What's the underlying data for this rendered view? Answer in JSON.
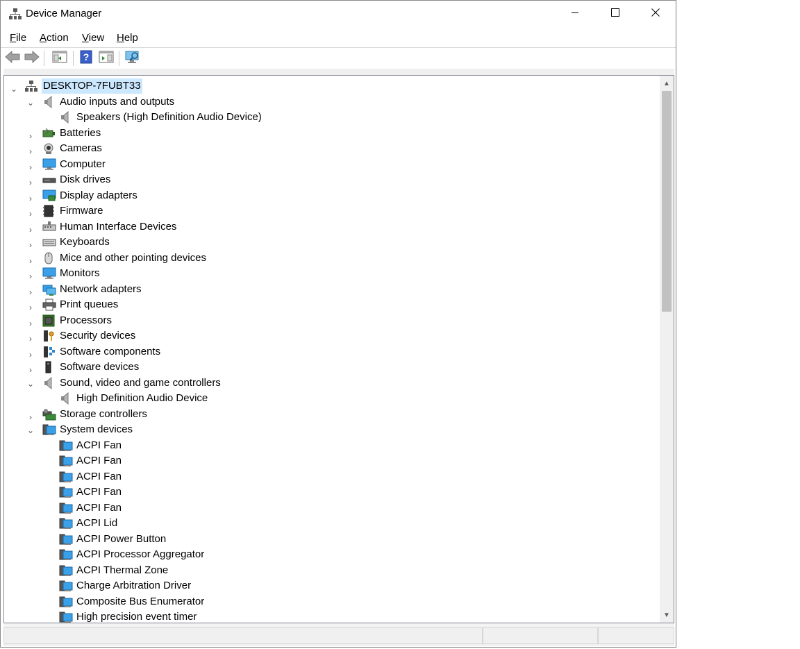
{
  "window": {
    "title": "Device Manager"
  },
  "title_buttons": {
    "minimize": "minimize-icon",
    "maximize": "maximize-icon",
    "close": "close-icon"
  },
  "menu": [
    {
      "label_first": "F",
      "label_rest": "ile"
    },
    {
      "label_first": "A",
      "label_rest": "ction"
    },
    {
      "label_first": "V",
      "label_rest": "iew"
    },
    {
      "label_first": "H",
      "label_rest": "elp"
    }
  ],
  "toolbar": [
    "back-icon",
    "forward-icon",
    "show-hide-console-tree-icon",
    "help-icon",
    "properties-icon",
    "scan-hardware-icon"
  ],
  "tree": {
    "root": "DESKTOP-7FUBT33",
    "rows": [
      {
        "label": "Audio inputs and outputs",
        "level": 1,
        "expanded": true,
        "icon": "speaker-icon"
      },
      {
        "label": "Speakers (High Definition Audio Device)",
        "level": 2,
        "icon": "speaker-icon"
      },
      {
        "label": "Batteries",
        "level": 1,
        "expanded": false,
        "icon": "battery-icon"
      },
      {
        "label": "Cameras",
        "level": 1,
        "expanded": false,
        "icon": "camera-icon"
      },
      {
        "label": "Computer",
        "level": 1,
        "expanded": false,
        "icon": "computer-icon"
      },
      {
        "label": "Disk drives",
        "level": 1,
        "expanded": false,
        "icon": "disk-drive-icon"
      },
      {
        "label": "Display adapters",
        "level": 1,
        "expanded": false,
        "icon": "display-adapter-icon"
      },
      {
        "label": "Firmware",
        "level": 1,
        "expanded": false,
        "icon": "firmware-icon"
      },
      {
        "label": "Human Interface Devices",
        "level": 1,
        "expanded": false,
        "icon": "hid-icon"
      },
      {
        "label": "Keyboards",
        "level": 1,
        "expanded": false,
        "icon": "keyboard-icon"
      },
      {
        "label": "Mice and other pointing devices",
        "level": 1,
        "expanded": false,
        "icon": "mouse-icon"
      },
      {
        "label": "Monitors",
        "level": 1,
        "expanded": false,
        "icon": "monitor-icon"
      },
      {
        "label": "Network adapters",
        "level": 1,
        "expanded": false,
        "icon": "network-adapter-icon"
      },
      {
        "label": "Print queues",
        "level": 1,
        "expanded": false,
        "icon": "printer-icon"
      },
      {
        "label": "Processors",
        "level": 1,
        "expanded": false,
        "icon": "processor-icon"
      },
      {
        "label": "Security devices",
        "level": 1,
        "expanded": false,
        "icon": "security-device-icon"
      },
      {
        "label": "Software components",
        "level": 1,
        "expanded": false,
        "icon": "software-component-icon"
      },
      {
        "label": "Software devices",
        "level": 1,
        "expanded": false,
        "icon": "software-device-icon"
      },
      {
        "label": "Sound, video and game controllers",
        "level": 1,
        "expanded": true,
        "icon": "speaker-icon"
      },
      {
        "label": "High Definition Audio Device",
        "level": 2,
        "icon": "speaker-icon"
      },
      {
        "label": "Storage controllers",
        "level": 1,
        "expanded": false,
        "icon": "storage-controller-icon"
      },
      {
        "label": "System devices",
        "level": 1,
        "expanded": true,
        "icon": "system-device-icon"
      },
      {
        "label": "ACPI Fan",
        "level": 2,
        "icon": "system-device-icon"
      },
      {
        "label": "ACPI Fan",
        "level": 2,
        "icon": "system-device-icon"
      },
      {
        "label": "ACPI Fan",
        "level": 2,
        "icon": "system-device-icon"
      },
      {
        "label": "ACPI Fan",
        "level": 2,
        "icon": "system-device-icon"
      },
      {
        "label": "ACPI Fan",
        "level": 2,
        "icon": "system-device-icon"
      },
      {
        "label": "ACPI Lid",
        "level": 2,
        "icon": "system-device-icon"
      },
      {
        "label": "ACPI Power Button",
        "level": 2,
        "icon": "system-device-icon"
      },
      {
        "label": "ACPI Processor Aggregator",
        "level": 2,
        "icon": "system-device-icon"
      },
      {
        "label": "ACPI Thermal Zone",
        "level": 2,
        "icon": "system-device-icon"
      },
      {
        "label": "Charge Arbitration Driver",
        "level": 2,
        "icon": "system-device-icon"
      },
      {
        "label": "Composite Bus Enumerator",
        "level": 2,
        "icon": "system-device-icon"
      },
      {
        "label": "High precision event timer",
        "level": 2,
        "icon": "system-device-icon"
      }
    ]
  },
  "colors": {
    "selection": "#cce8ff",
    "accent": "#2b88d8",
    "chrome": "#f0f0f0"
  }
}
